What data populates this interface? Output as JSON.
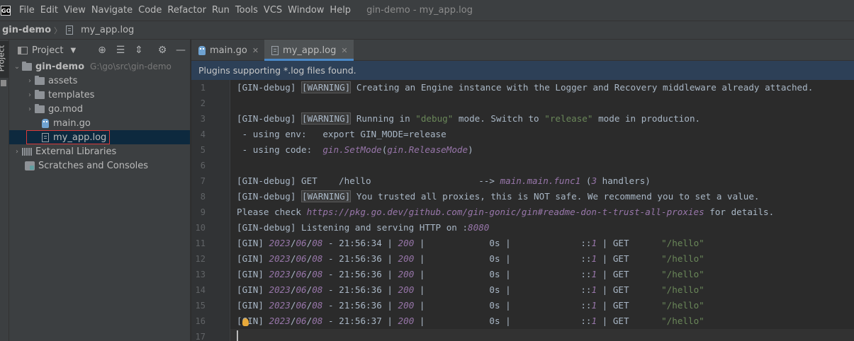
{
  "app": {
    "logo_text": "GO",
    "window_title": "gin-demo - my_app.log",
    "menu": [
      "File",
      "Edit",
      "View",
      "Navigate",
      "Code",
      "Refactor",
      "Run",
      "Tools",
      "VCS",
      "Window",
      "Help"
    ]
  },
  "breadcrumb": {
    "project": "gin-demo",
    "file": "my_app.log"
  },
  "side_stripe": {
    "label": "Project"
  },
  "project_panel": {
    "title": "Project",
    "tree": {
      "root": {
        "label": "gin-demo",
        "path": "G:\\go\\src\\gin-demo"
      },
      "items": [
        {
          "label": "assets"
        },
        {
          "label": "templates"
        },
        {
          "label": "go.mod"
        },
        {
          "label": "main.go"
        },
        {
          "label": "my_app.log"
        }
      ],
      "external_libraries": "External Libraries",
      "scratches": "Scratches and Consoles"
    }
  },
  "editor_tabs": [
    {
      "label": "main.go"
    },
    {
      "label": "my_app.log"
    }
  ],
  "notification": "Plugins supporting *.log files found.",
  "code_lines": [
    {
      "n": "1",
      "segs": [
        [
          "[GIN-debug] ",
          ""
        ],
        [
          "[WARNING]",
          "warn"
        ],
        [
          " Creating an Engine instance with the Logger and Recovery middleware already attached.",
          ""
        ]
      ]
    },
    {
      "n": "2",
      "segs": []
    },
    {
      "n": "3",
      "segs": [
        [
          "[GIN-debug] ",
          ""
        ],
        [
          "[WARNING]",
          "warn"
        ],
        [
          " Running in ",
          ""
        ],
        [
          "\"debug\"",
          "str"
        ],
        [
          " mode. Switch to ",
          ""
        ],
        [
          "\"release\"",
          "str"
        ],
        [
          " mode in production.",
          ""
        ]
      ]
    },
    {
      "n": "4",
      "segs": [
        [
          " - using env:   export GIN_MODE=release",
          ""
        ]
      ]
    },
    {
      "n": "5",
      "segs": [
        [
          " - using code:  ",
          ""
        ],
        [
          "gin.SetMode",
          "it"
        ],
        [
          "(",
          ""
        ],
        [
          "gin.ReleaseMode",
          "it"
        ],
        [
          ")",
          ""
        ]
      ]
    },
    {
      "n": "6",
      "segs": []
    },
    {
      "n": "7",
      "segs": [
        [
          "[GIN-debug] GET    /hello                    --> ",
          ""
        ],
        [
          "main.main.func1",
          "it"
        ],
        [
          " (",
          ""
        ],
        [
          "3",
          "num"
        ],
        [
          " handlers)",
          ""
        ]
      ]
    },
    {
      "n": "8",
      "segs": [
        [
          "[GIN-debug] ",
          ""
        ],
        [
          "[WARNING]",
          "warn"
        ],
        [
          " You trusted all proxies, this is NOT safe. We recommend you to set a value.",
          ""
        ]
      ]
    },
    {
      "n": "9",
      "segs": [
        [
          "Please check ",
          ""
        ],
        [
          "https://pkg.go.dev/github.com/gin-gonic/gin#readme-don-t-trust-all-proxies",
          "link"
        ],
        [
          " for details.",
          ""
        ]
      ]
    },
    {
      "n": "10",
      "segs": [
        [
          "[GIN-debug] Listening and serving HTTP on :",
          ""
        ],
        [
          "8080",
          "num"
        ]
      ]
    },
    {
      "n": "11",
      "segs": [
        [
          "[GIN] ",
          ""
        ],
        [
          "2023",
          "num"
        ],
        [
          "/",
          ""
        ],
        [
          "06",
          "num"
        ],
        [
          "/",
          ""
        ],
        [
          "08",
          "num"
        ],
        [
          " - 21:56:34 | ",
          ""
        ],
        [
          "200",
          "num"
        ],
        [
          " |            0s |             ::",
          ""
        ],
        [
          "1",
          "num"
        ],
        [
          " | GET      ",
          ""
        ],
        [
          "\"/hello\"",
          "str"
        ]
      ]
    },
    {
      "n": "12",
      "segs": [
        [
          "[GIN] ",
          ""
        ],
        [
          "2023",
          "num"
        ],
        [
          "/",
          ""
        ],
        [
          "06",
          "num"
        ],
        [
          "/",
          ""
        ],
        [
          "08",
          "num"
        ],
        [
          " - 21:56:36 | ",
          ""
        ],
        [
          "200",
          "num"
        ],
        [
          " |            0s |             ::",
          ""
        ],
        [
          "1",
          "num"
        ],
        [
          " | GET      ",
          ""
        ],
        [
          "\"/hello\"",
          "str"
        ]
      ]
    },
    {
      "n": "13",
      "segs": [
        [
          "[GIN] ",
          ""
        ],
        [
          "2023",
          "num"
        ],
        [
          "/",
          ""
        ],
        [
          "06",
          "num"
        ],
        [
          "/",
          ""
        ],
        [
          "08",
          "num"
        ],
        [
          " - 21:56:36 | ",
          ""
        ],
        [
          "200",
          "num"
        ],
        [
          " |            0s |             ::",
          ""
        ],
        [
          "1",
          "num"
        ],
        [
          " | GET      ",
          ""
        ],
        [
          "\"/hello\"",
          "str"
        ]
      ]
    },
    {
      "n": "14",
      "segs": [
        [
          "[GIN] ",
          ""
        ],
        [
          "2023",
          "num"
        ],
        [
          "/",
          ""
        ],
        [
          "06",
          "num"
        ],
        [
          "/",
          ""
        ],
        [
          "08",
          "num"
        ],
        [
          " - 21:56:36 | ",
          ""
        ],
        [
          "200",
          "num"
        ],
        [
          " |            0s |             ::",
          ""
        ],
        [
          "1",
          "num"
        ],
        [
          " | GET      ",
          ""
        ],
        [
          "\"/hello\"",
          "str"
        ]
      ]
    },
    {
      "n": "15",
      "segs": [
        [
          "[GIN] ",
          ""
        ],
        [
          "2023",
          "num"
        ],
        [
          "/",
          ""
        ],
        [
          "06",
          "num"
        ],
        [
          "/",
          ""
        ],
        [
          "08",
          "num"
        ],
        [
          " - 21:56:36 | ",
          ""
        ],
        [
          "200",
          "num"
        ],
        [
          " |            0s |             ::",
          ""
        ],
        [
          "1",
          "num"
        ],
        [
          " | GET      ",
          ""
        ],
        [
          "\"/hello\"",
          "str"
        ]
      ]
    },
    {
      "n": "16",
      "segs": [
        [
          "[GIN] ",
          ""
        ],
        [
          "2023",
          "num"
        ],
        [
          "/",
          ""
        ],
        [
          "06",
          "num"
        ],
        [
          "/",
          ""
        ],
        [
          "08",
          "num"
        ],
        [
          " - 21:56:37 | ",
          ""
        ],
        [
          "200",
          "num"
        ],
        [
          " |            0s |             ::",
          ""
        ],
        [
          "1",
          "num"
        ],
        [
          " | GET      ",
          ""
        ],
        [
          "\"/hello\"",
          "str"
        ]
      ]
    },
    {
      "n": "17",
      "segs": []
    }
  ]
}
